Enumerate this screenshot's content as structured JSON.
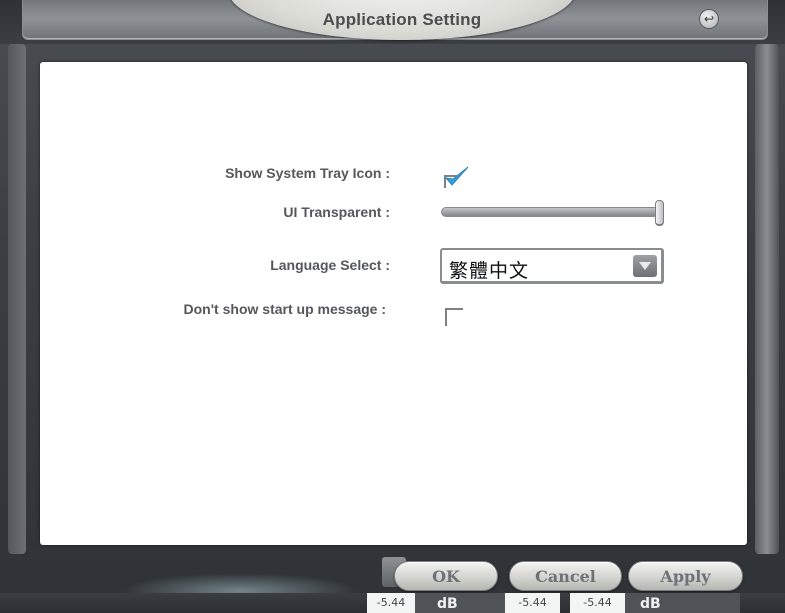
{
  "window": {
    "title": "Application Setting",
    "restore_icon": "restore-icon"
  },
  "settings": {
    "show_tray_label": "Show System Tray Icon :",
    "show_tray_checked": true,
    "transparent_label": "UI Transparent :",
    "transparency_level_percent": 100,
    "language_label": "Language Select :",
    "language_value": "繁體中文",
    "startup_label": "Don't show start up message :",
    "startup_checked": false
  },
  "buttons": {
    "ok": "OK",
    "cancel": "Cancel",
    "apply": "Apply"
  },
  "levels": {
    "left_value": "-5.44",
    "mid_left_value": "-5.44",
    "mid_right_value": "-5.44",
    "unit": "dB"
  },
  "colors": {
    "checkmark": "#3a9fd6",
    "panel_bg": "#ffffff",
    "frame_bg": "#3b3e43"
  }
}
